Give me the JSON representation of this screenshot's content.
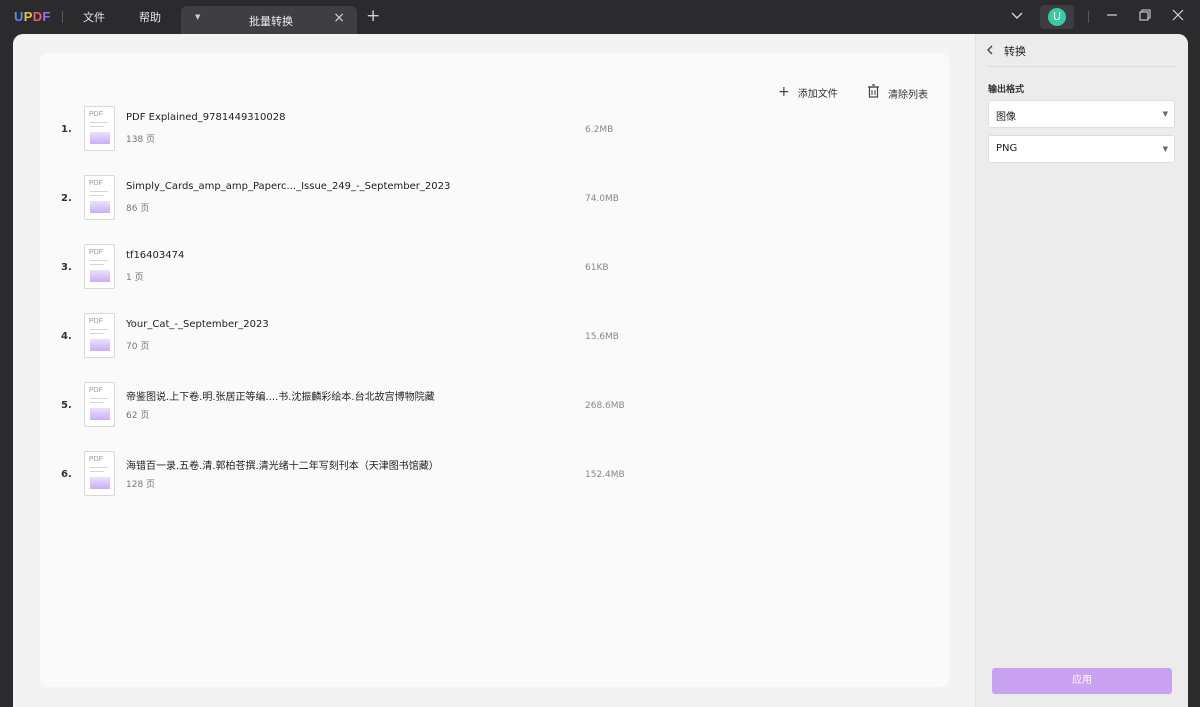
{
  "titlebar": {
    "logo": [
      "U",
      "P",
      "D",
      "F"
    ],
    "menu": [
      "文件",
      "帮助"
    ],
    "tab_label": "批量转换",
    "avatar_letter": "U"
  },
  "toolbar": {
    "add_files": "添加文件",
    "clear_list": "清除列表"
  },
  "files": [
    {
      "num": "1.",
      "name": "PDF Explained_9781449310028",
      "pages": "138 页",
      "size": "6.2MB"
    },
    {
      "num": "2.",
      "name": "Simply_Cards_amp_amp_Paperc..._Issue_249_-_September_2023",
      "pages": "86 页",
      "size": "74.0MB"
    },
    {
      "num": "3.",
      "name": "tf16403474",
      "pages": "1 页",
      "size": "61KB"
    },
    {
      "num": "4.",
      "name": "Your_Cat_-_September_2023",
      "pages": "70 页",
      "size": "15.6MB"
    },
    {
      "num": "5.",
      "name": "帝鉴图说.上下卷.明.张居正等编....书.沈振麟彩绘本.台北故宫博物院藏",
      "pages": "62 页",
      "size": "268.6MB"
    },
    {
      "num": "6.",
      "name": "海错百一录.五卷.清.郭柏苍撰.清光绪十二年写刻刊本（天津图书馆藏）",
      "pages": "128 页",
      "size": "152.4MB"
    }
  ],
  "side_panel": {
    "title": "转换",
    "output_format_label": "输出格式",
    "format_select": "图像",
    "image_type_select": "PNG",
    "apply_label": "应用"
  },
  "colors": {
    "accent": "#c9a3f2",
    "titlebar": "#2b2b2e",
    "avatar": "#3ac9a4"
  },
  "icons": [
    "plus-icon",
    "trash-icon",
    "pdf-file-icon",
    "chevron-left-icon",
    "chevron-down-icon",
    "close-icon",
    "minimize-icon",
    "restore-icon"
  ]
}
